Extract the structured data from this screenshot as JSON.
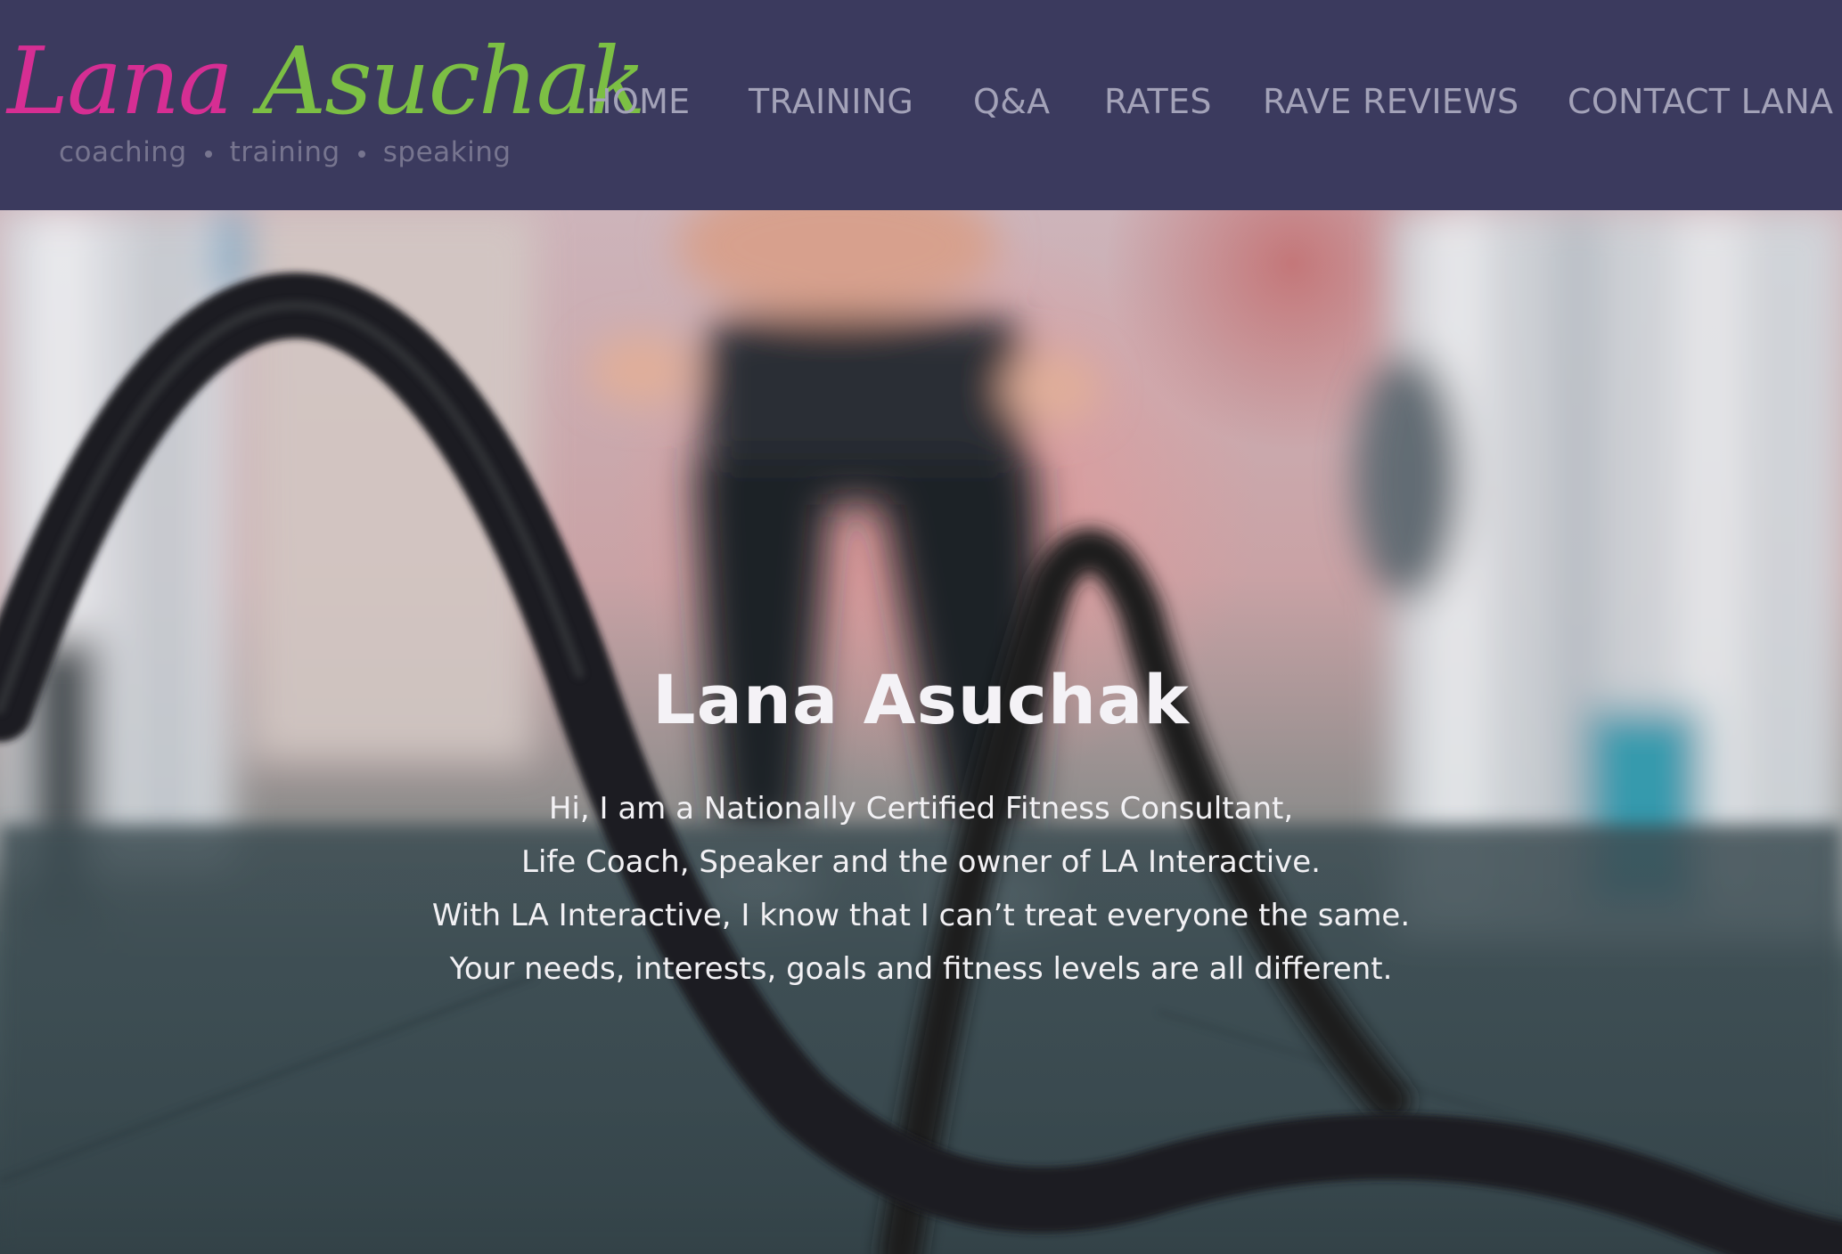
{
  "brand": {
    "first_name": "Lana",
    "last_name": "Asuchak",
    "tagline": [
      "coaching",
      "training",
      "speaking"
    ],
    "colors": {
      "first_name": "#d62e93",
      "last_name": "#7cbf44",
      "header_bg": "#3b3a5e",
      "nav_text": "#a3a2b8"
    }
  },
  "nav": {
    "items": [
      {
        "label": "HOME"
      },
      {
        "label": "TRAINING"
      },
      {
        "label": "Q&A"
      },
      {
        "label": "RATES"
      },
      {
        "label": "RAVE REVIEWS"
      },
      {
        "label": "CONTACT LANA"
      }
    ]
  },
  "hero": {
    "title": "Lana Asuchak",
    "lines": [
      "Hi, I am a Nationally Certified Fitness Consultant,",
      "Life Coach, Speaker and the owner of LA Interactive.",
      "With LA Interactive, I know that I can’t treat everyone the same.",
      "Your needs, interests, goals and fitness levels are all different."
    ]
  }
}
